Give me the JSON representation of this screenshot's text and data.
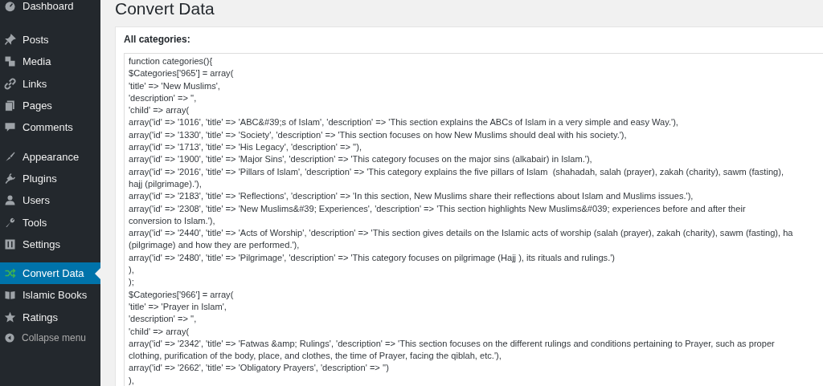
{
  "sidebar": {
    "groups": [
      {
        "items": [
          {
            "label": "Dashboard",
            "selected": false
          }
        ]
      },
      {
        "items": [
          {
            "label": "Posts",
            "selected": false
          },
          {
            "label": "Media",
            "selected": false
          },
          {
            "label": "Links",
            "selected": false
          },
          {
            "label": "Pages",
            "selected": false
          },
          {
            "label": "Comments",
            "selected": false
          }
        ]
      },
      {
        "items": [
          {
            "label": "Appearance",
            "selected": false
          },
          {
            "label": "Plugins",
            "selected": false
          },
          {
            "label": "Users",
            "selected": false
          },
          {
            "label": "Tools",
            "selected": false
          },
          {
            "label": "Settings",
            "selected": false
          }
        ]
      },
      {
        "items": [
          {
            "label": "Convert Data",
            "selected": true
          },
          {
            "label": "Islamic Books",
            "selected": false
          },
          {
            "label": "Ratings",
            "selected": false
          }
        ]
      }
    ],
    "collapse_button": {
      "label": "Collapse menu"
    }
  },
  "page_title": "Convert Data",
  "panel": {
    "label": "All categories:",
    "code_lines": [
      "function categories(){",
      "$Categories['965'] = array(",
      "'title' => 'New Muslims',",
      "'description' => '',",
      "'child' => array(",
      "array('id' => '1016', 'title' => 'ABC&#39;s of Islam', 'description' => 'This section explains the ABCs of Islam in a very simple and easy Way.'),",
      "array('id' => '1330', 'title' => 'Society', 'description' => 'This section focuses on how New Muslims should deal with his society.'),",
      "array('id' => '1713', 'title' => 'His Legacy', 'description' => ''),",
      "array('id' => '1900', 'title' => 'Major Sins', 'description' => 'This category focuses on the major sins (alkabair) in Islam.'),",
      "array('id' => '2016', 'title' => 'Pillars of Islam', 'description' => 'This category explains the five pillars of Islam  (shahadah, salah (prayer), zakah (charity), sawm (fasting),",
      "hajj (pilgrimage).'),",
      "array('id' => '2183', 'title' => 'Reflections', 'description' => 'In this section, New Muslims share their reflections about Islam and Muslims issues.'),",
      "array('id' => '2308', 'title' => 'New Muslims&#39; Experiences', 'description' => 'This section highlights New Muslims&#039; experiences before and after their",
      "conversion to Islam.'),",
      "array('id' => '2440', 'title' => 'Acts of Worship', 'description' => 'This section gives details on the Islamic acts of worship (salah (prayer), zakah (charity), sawm (fasting), ha",
      "(pilgrimage) and how they are performed.'),",
      "array('id' => '2480', 'title' => 'Pilgrimage', 'description' => 'This category focuses on pilgrimage (Hajj ), its rituals and rulings.')",
      "),",
      ");",
      "$Categories['966'] = array(",
      "'title' => 'Prayer in Islam',",
      "'description' => '',",
      "'child' => array(",
      "array('id' => '2342', 'title' => 'Fatwas &amp; Rulings', 'description' => 'This section focuses on the different rulings and conditions pertaining to Prayer, such as proper",
      "clothing, purification of the body, place, and clothes, the time of Prayer, facing the qiblah, etc.'),",
      "array('id' => '2662', 'title' => 'Obligatory Prayers', 'description' => '')",
      "),"
    ]
  }
}
